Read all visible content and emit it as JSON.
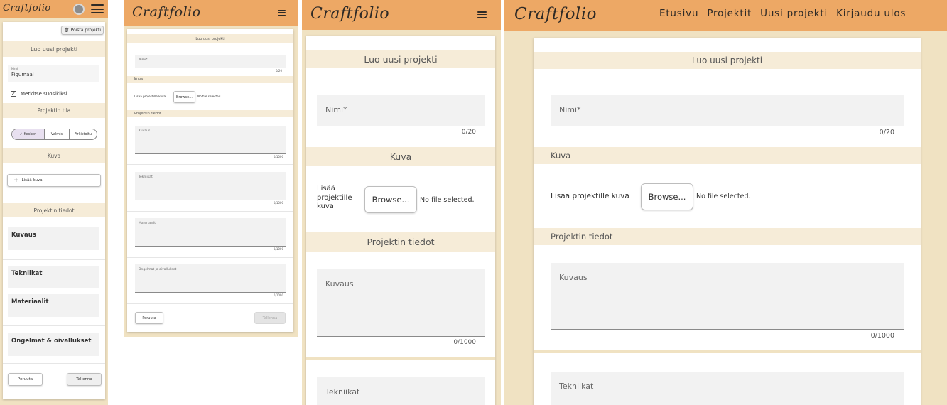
{
  "app": {
    "logo": "Craftfolio"
  },
  "nav": {
    "items": [
      "Etusivu",
      "Projektit",
      "Uusi projekti",
      "Kirjaudu ulos"
    ]
  },
  "form": {
    "delete_button": "Poista projekti",
    "title": "Luo uusi projekti",
    "name_label": "Nimi",
    "name_label_required": "Nimi*",
    "name_value": "Figumaal",
    "name_counter": "0/20",
    "favorite_label": "Merkitse suosikiksi",
    "status_section": "Projektin tila",
    "status_options": [
      "Kesken",
      "Valmis",
      "Arkistoitu"
    ],
    "image_section": "Kuva",
    "add_image_button": "Lisää kuva",
    "add_image_label": "Lisää projektille kuva",
    "add_image_label_wrapped": [
      "Lisää",
      "projektille",
      "kuva"
    ],
    "browse_button": "Browse...",
    "no_file": "No file selected.",
    "details_section": "Projektin tiedot",
    "fields": [
      "Kuvaus",
      "Tekniikat",
      "Materiaalit",
      "Ongelmat ja oivallukset"
    ],
    "fields_p1": [
      "Kuvaus",
      "Tekniikat",
      "Materiaalit",
      "Ongelmat & oivallukset"
    ],
    "field_counter": "0/1000",
    "cancel_button": "Peruuta",
    "save_button": "Tallenna"
  },
  "colors": {
    "header": "#eda865",
    "page_bg": "#f0e2c2",
    "band": "#f6ecd8"
  }
}
